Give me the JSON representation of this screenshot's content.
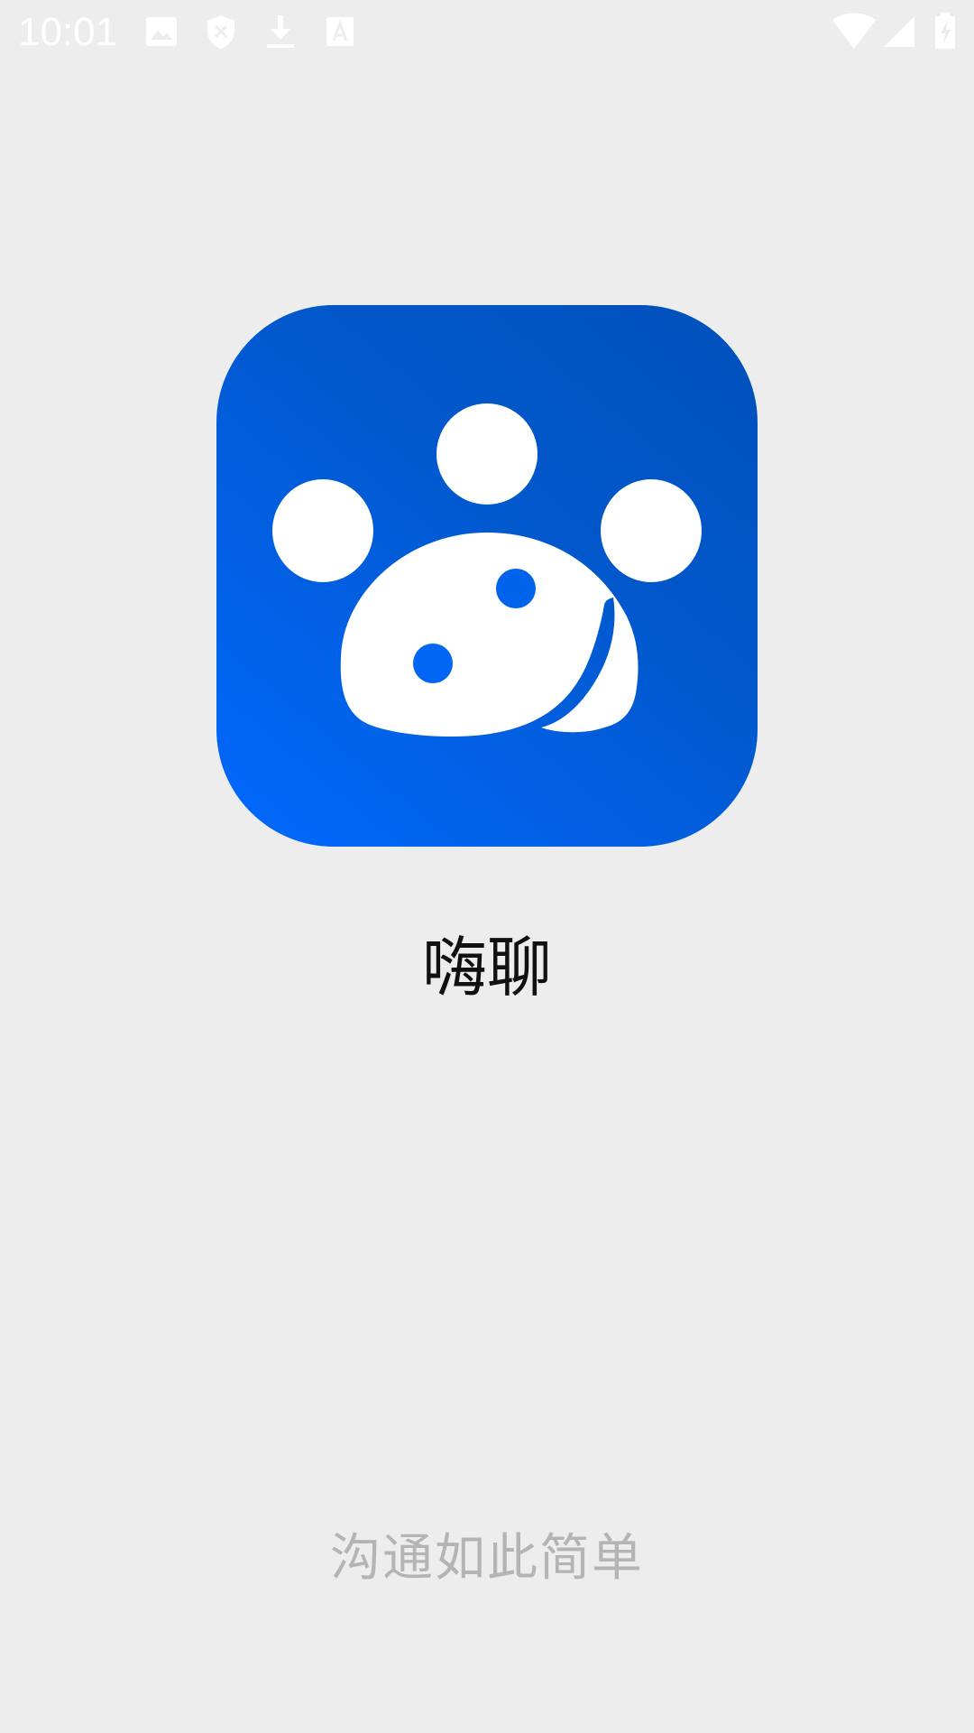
{
  "status_bar": {
    "time": "10:01",
    "left_icons": [
      "image-icon",
      "shield-icon",
      "download-icon",
      "text-recognition-icon"
    ],
    "right_icons": [
      "wifi-icon",
      "cell-signal-icon",
      "battery-charging-icon"
    ],
    "icon_color": "#ffffff"
  },
  "splash": {
    "app_icon": "paw-logo-icon",
    "app_name": "嗨聊",
    "slogan": "沟通如此简单",
    "brand_color": "#0169ff",
    "background_color": "#ededee"
  }
}
